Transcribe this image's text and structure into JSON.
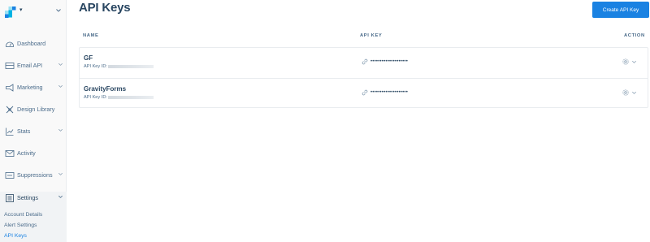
{
  "sidebar": {
    "brand_caret": "▾",
    "items": [
      {
        "label": "Dashboard",
        "icon": "dashboard-icon",
        "has_chevron": false
      },
      {
        "label": "Email API",
        "icon": "email-api-icon",
        "has_chevron": true
      },
      {
        "label": "Marketing",
        "icon": "marketing-icon",
        "has_chevron": true
      },
      {
        "label": "Design Library",
        "icon": "design-library-icon",
        "has_chevron": false
      },
      {
        "label": "Stats",
        "icon": "stats-icon",
        "has_chevron": true
      },
      {
        "label": "Activity",
        "icon": "activity-icon",
        "has_chevron": false
      },
      {
        "label": "Suppressions",
        "icon": "suppressions-icon",
        "has_chevron": true
      },
      {
        "label": "Settings",
        "icon": "settings-icon",
        "has_chevron": true
      }
    ],
    "settings_links": [
      {
        "label": "Account Details"
      },
      {
        "label": "Alert Settings"
      },
      {
        "label": "API Keys",
        "active": true
      }
    ]
  },
  "header": {
    "title": "API Keys",
    "create_button": "Create API Key"
  },
  "table": {
    "columns": [
      "NAME",
      "API KEY",
      "ACTION"
    ],
    "rows": [
      {
        "name": "GF",
        "id_prefix": "API Key ID:",
        "masked_key": "••••••••••••••••••••"
      },
      {
        "name": "GravityForms",
        "id_prefix": "API Key ID:",
        "masked_key": "••••••••••••••••••••"
      }
    ]
  },
  "colors": {
    "primary": "#1a82e2",
    "text": "#294661",
    "muted": "#4a6b8a",
    "sidebar_bg": "#f9f9f9",
    "border": "#e9ecef"
  }
}
